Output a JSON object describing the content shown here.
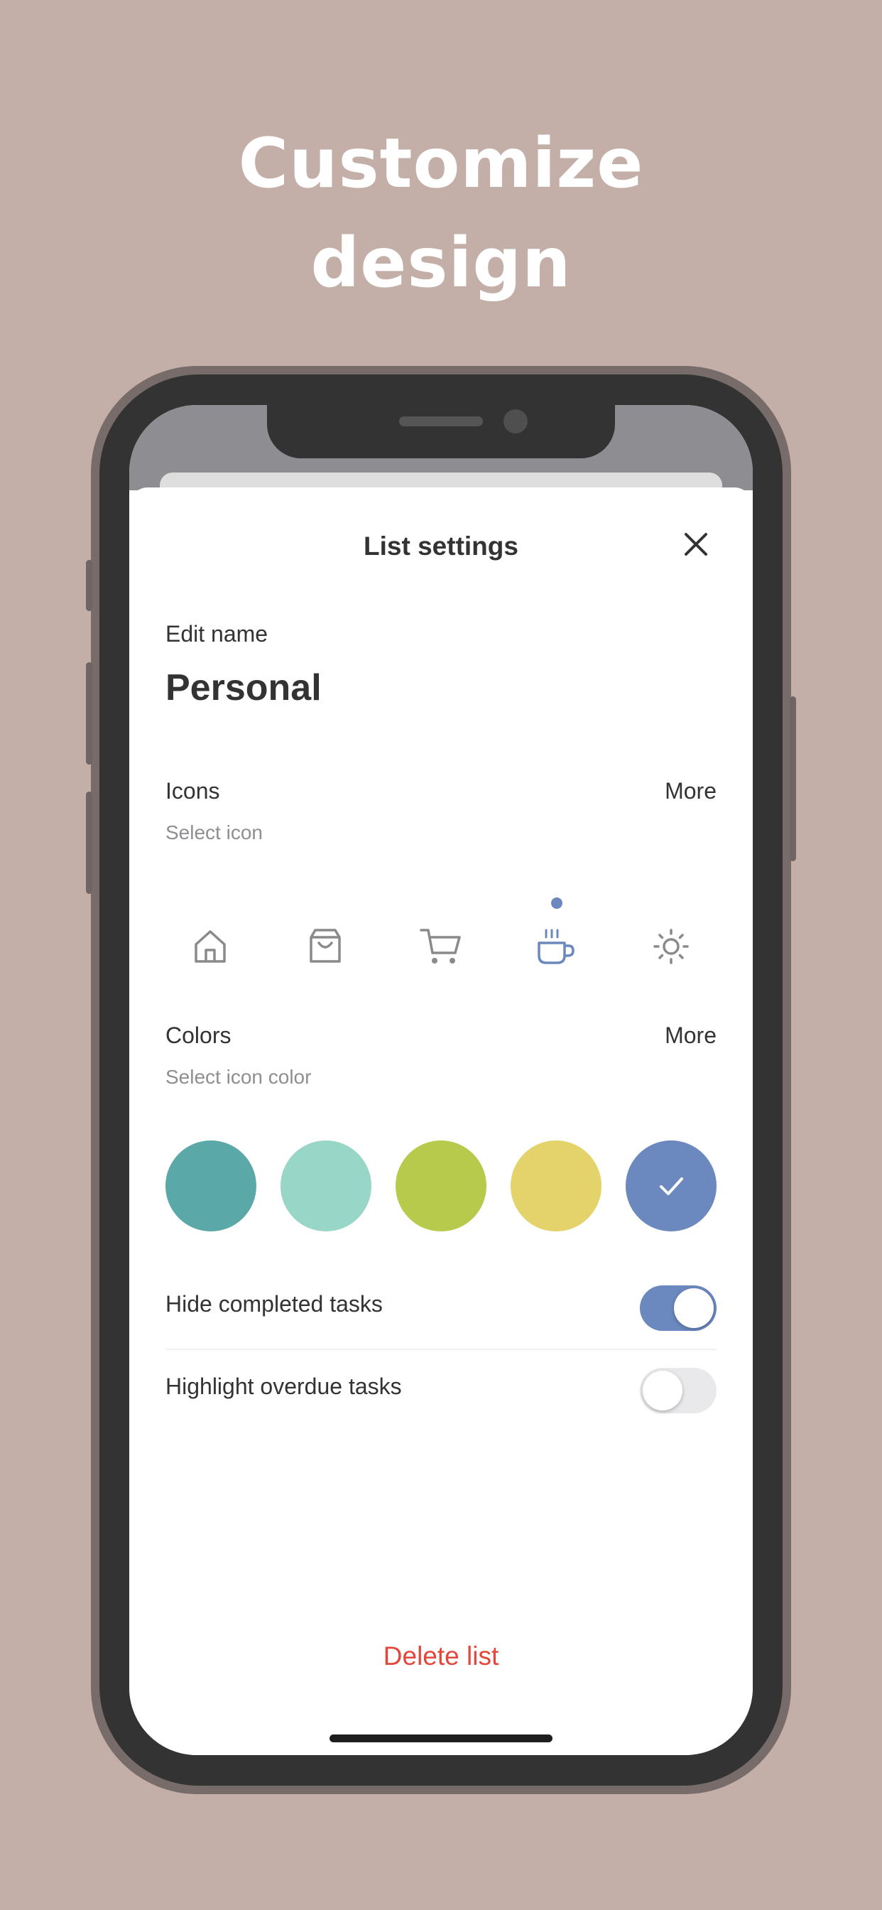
{
  "headline": {
    "line1": "Customize",
    "line2": "design"
  },
  "sheet": {
    "title": "List settings",
    "close_icon": "close-icon"
  },
  "edit_name": {
    "label": "Edit name",
    "value": "Personal"
  },
  "icons_section": {
    "label": "Icons",
    "more": "More",
    "hint": "Select icon",
    "items": [
      "home-icon",
      "bag-icon",
      "cart-icon",
      "cup-icon",
      "sun-icon"
    ],
    "selected": "cup-icon"
  },
  "colors_section": {
    "label": "Colors",
    "more": "More",
    "hint": "Select icon color",
    "swatches": [
      "#5ba8a8",
      "#98d6c7",
      "#b8ca4c",
      "#e3d36a",
      "#6b88bf"
    ],
    "selected": "#6b88bf"
  },
  "toggles": {
    "hide_completed": {
      "label": "Hide completed tasks",
      "on": true
    },
    "highlight_overdue": {
      "label": "Highlight overdue tasks",
      "on": false
    }
  },
  "delete_label": "Delete list",
  "theme": {
    "accent": "#6b88bf",
    "danger": "#e5463c",
    "background": "#c4afa8"
  }
}
